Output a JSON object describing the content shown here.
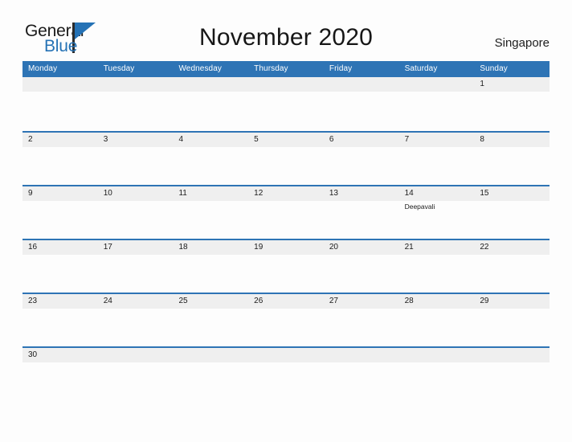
{
  "logo": {
    "word_one": "General",
    "word_two": "Blue",
    "flag_icon": "triangle-flag-icon",
    "brand_color": "#2572b5"
  },
  "header": {
    "title": "November 2020",
    "country": "Singapore"
  },
  "calendar": {
    "header_color": "#2e74b5",
    "band_color": "#efefef",
    "weekdays": [
      "Monday",
      "Tuesday",
      "Wednesday",
      "Thursday",
      "Friday",
      "Saturday",
      "Sunday"
    ],
    "weeks": [
      [
        {
          "day": "",
          "event": ""
        },
        {
          "day": "",
          "event": ""
        },
        {
          "day": "",
          "event": ""
        },
        {
          "day": "",
          "event": ""
        },
        {
          "day": "",
          "event": ""
        },
        {
          "day": "",
          "event": ""
        },
        {
          "day": "1",
          "event": ""
        }
      ],
      [
        {
          "day": "2",
          "event": ""
        },
        {
          "day": "3",
          "event": ""
        },
        {
          "day": "4",
          "event": ""
        },
        {
          "day": "5",
          "event": ""
        },
        {
          "day": "6",
          "event": ""
        },
        {
          "day": "7",
          "event": ""
        },
        {
          "day": "8",
          "event": ""
        }
      ],
      [
        {
          "day": "9",
          "event": ""
        },
        {
          "day": "10",
          "event": ""
        },
        {
          "day": "11",
          "event": ""
        },
        {
          "day": "12",
          "event": ""
        },
        {
          "day": "13",
          "event": ""
        },
        {
          "day": "14",
          "event": "Deepavali"
        },
        {
          "day": "15",
          "event": ""
        }
      ],
      [
        {
          "day": "16",
          "event": ""
        },
        {
          "day": "17",
          "event": ""
        },
        {
          "day": "18",
          "event": ""
        },
        {
          "day": "19",
          "event": ""
        },
        {
          "day": "20",
          "event": ""
        },
        {
          "day": "21",
          "event": ""
        },
        {
          "day": "22",
          "event": ""
        }
      ],
      [
        {
          "day": "23",
          "event": ""
        },
        {
          "day": "24",
          "event": ""
        },
        {
          "day": "25",
          "event": ""
        },
        {
          "day": "26",
          "event": ""
        },
        {
          "day": "27",
          "event": ""
        },
        {
          "day": "28",
          "event": ""
        },
        {
          "day": "29",
          "event": ""
        }
      ],
      [
        {
          "day": "30",
          "event": ""
        },
        {
          "day": "",
          "event": ""
        },
        {
          "day": "",
          "event": ""
        },
        {
          "day": "",
          "event": ""
        },
        {
          "day": "",
          "event": ""
        },
        {
          "day": "",
          "event": ""
        },
        {
          "day": "",
          "event": ""
        }
      ]
    ]
  }
}
